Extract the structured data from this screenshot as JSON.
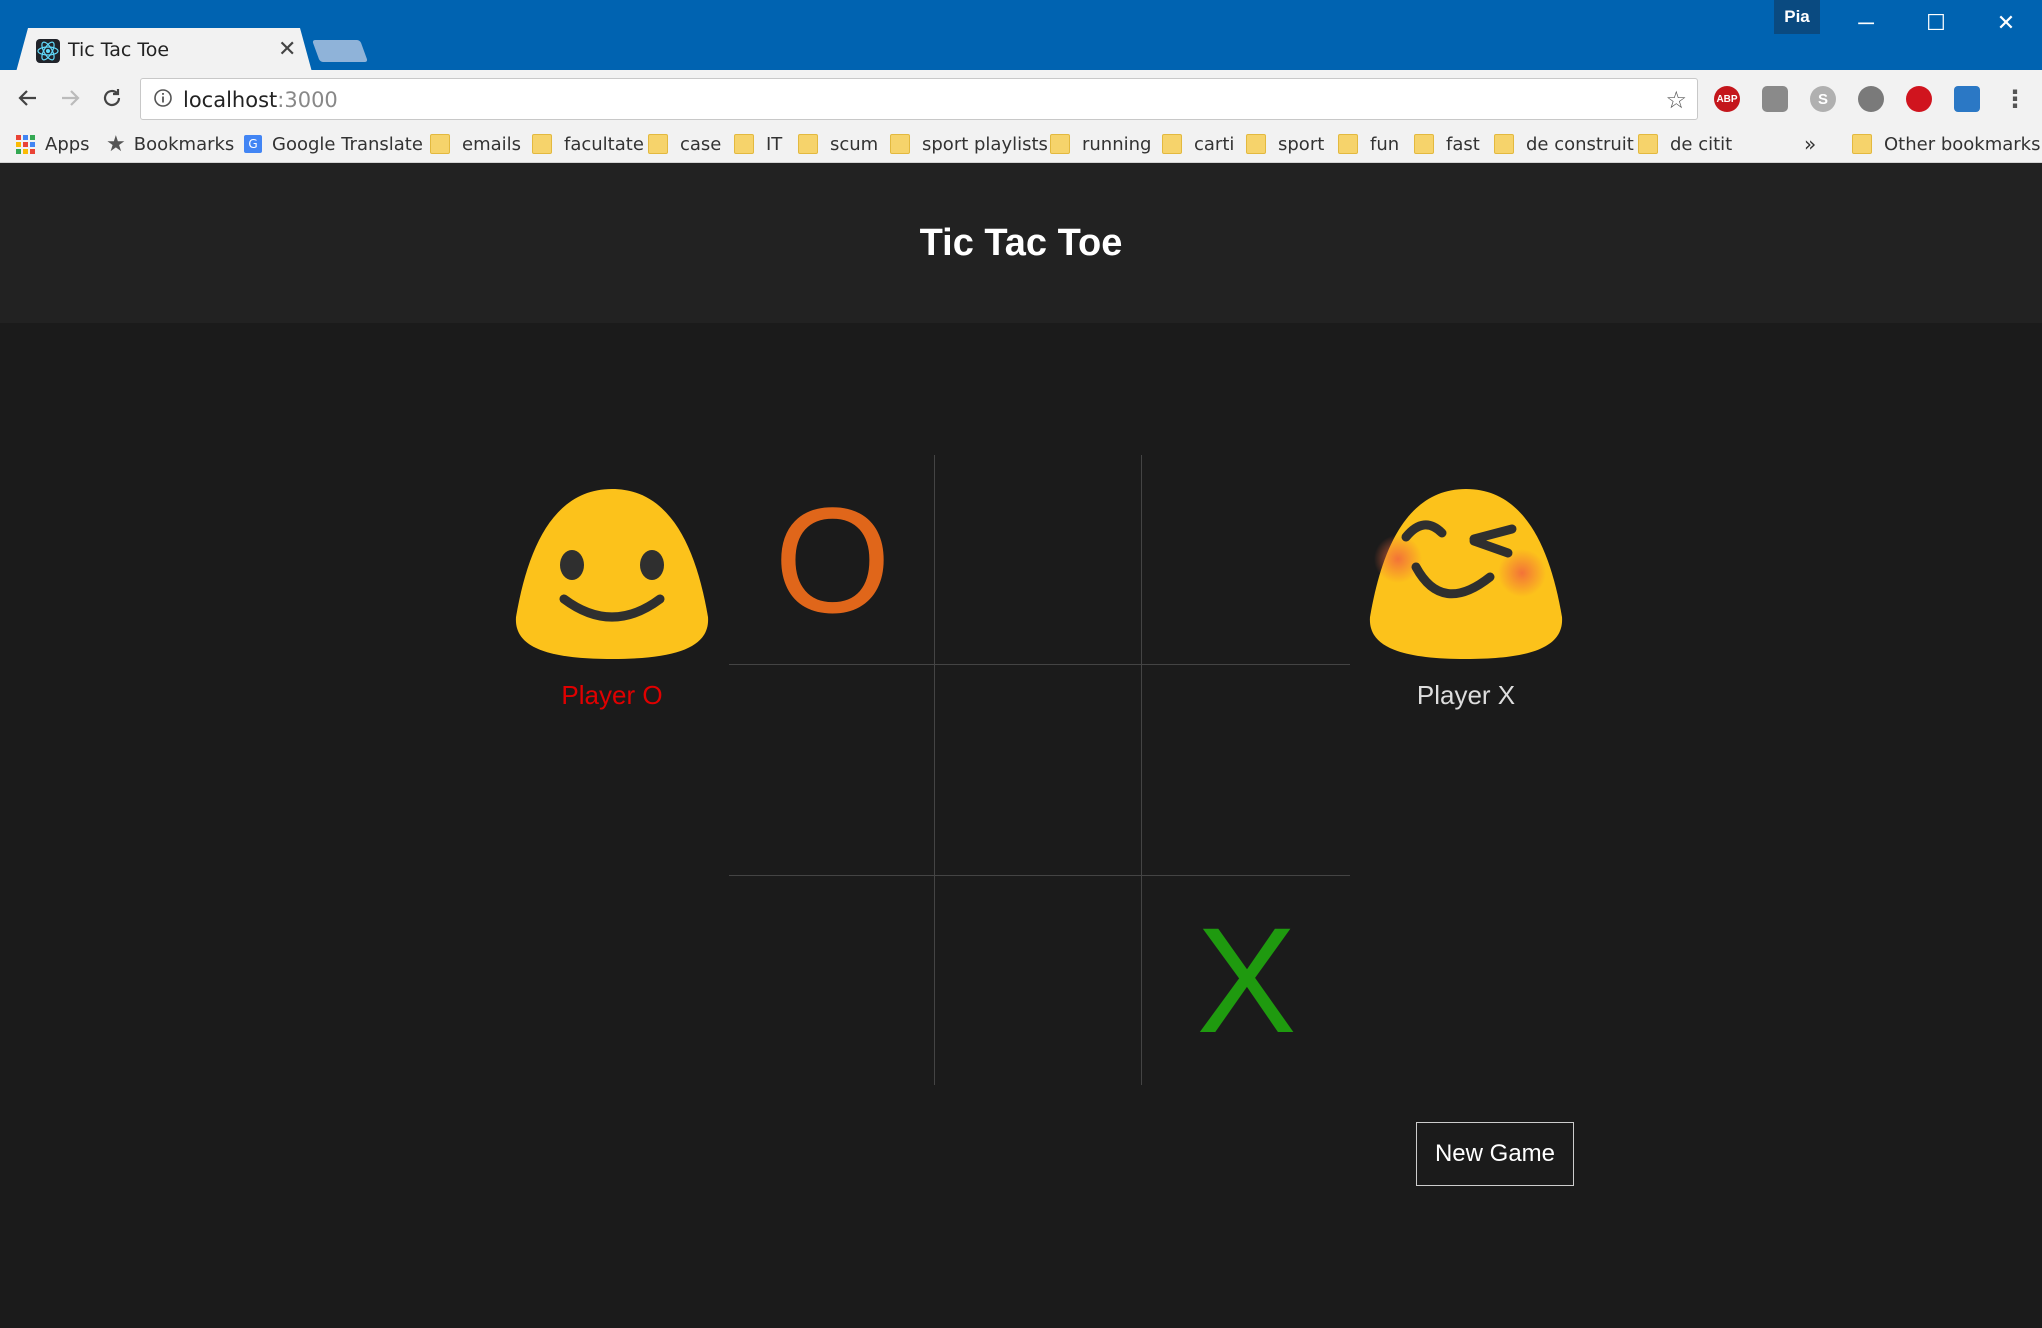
{
  "browser": {
    "tab_title": "Tic Tac Toe",
    "profile_name": "Pia",
    "url_host": "localhost",
    "url_port": ":3000",
    "bookmarks": [
      {
        "label": "Apps",
        "icon": "apps-grid-icon"
      },
      {
        "label": "Bookmarks",
        "icon": "star-icon"
      },
      {
        "label": "Google Translate",
        "icon": "google-translate-icon"
      },
      {
        "label": "emails",
        "icon": "folder-icon"
      },
      {
        "label": "facultate",
        "icon": "folder-icon"
      },
      {
        "label": "case",
        "icon": "folder-icon"
      },
      {
        "label": "IT",
        "icon": "folder-icon"
      },
      {
        "label": "scum",
        "icon": "folder-icon"
      },
      {
        "label": "sport playlists",
        "icon": "folder-icon"
      },
      {
        "label": "running",
        "icon": "folder-icon"
      },
      {
        "label": "carti",
        "icon": "folder-icon"
      },
      {
        "label": "sport",
        "icon": "folder-icon"
      },
      {
        "label": "fun",
        "icon": "folder-icon"
      },
      {
        "label": "fast",
        "icon": "folder-icon"
      },
      {
        "label": "de construit",
        "icon": "folder-icon"
      },
      {
        "label": "de citit",
        "icon": "folder-icon"
      }
    ],
    "bookmarks_overflow": "»",
    "other_bookmarks": "Other bookmarks"
  },
  "app": {
    "title": "Tic Tac Toe",
    "player_o": {
      "label": "Player O",
      "color": "#e00000",
      "emoji": "smiling-face-icon"
    },
    "player_x": {
      "label": "Player X",
      "color": "#dddddd",
      "emoji": "winking-blushing-face-icon"
    },
    "board": [
      "O",
      "",
      "",
      "",
      "",
      "",
      "",
      "",
      "X"
    ],
    "o_color": "#e0661a",
    "x_color": "#1f9a0f",
    "new_game_label": "New Game"
  }
}
